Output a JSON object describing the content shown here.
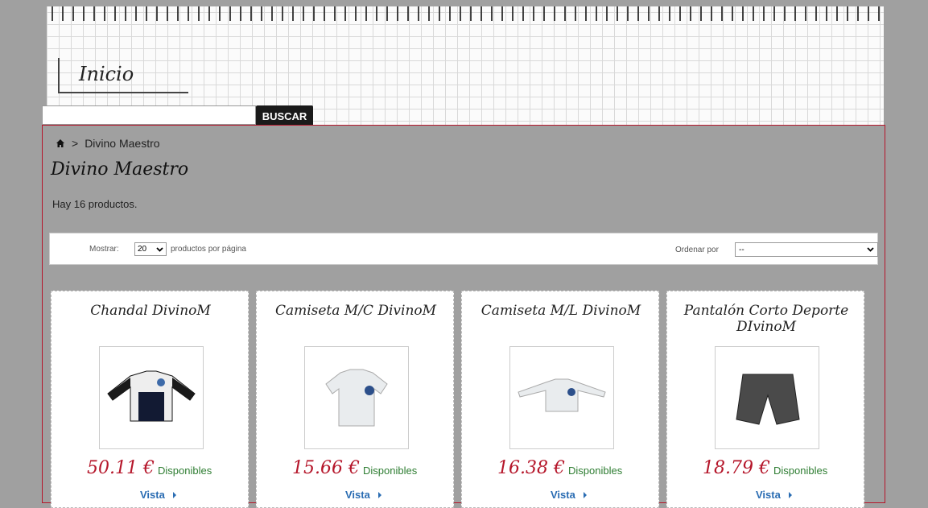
{
  "header": {
    "inicio_label": "Inicio",
    "search": {
      "placeholder": "",
      "button_label": "BUSCAR"
    }
  },
  "breadcrumb": {
    "separator": ">",
    "current": "Divino Maestro"
  },
  "category": {
    "title": "Divino Maestro",
    "count_text": "Hay 16 productos."
  },
  "toolbar": {
    "show_label": "Mostrar:",
    "show_value": "20",
    "per_page_label": "productos por página",
    "order_label": "Ordenar por",
    "order_value": "--"
  },
  "products": [
    {
      "title": "Chandal DivinoM",
      "price": "50.11 €",
      "availability": "Disponibles",
      "view_label": "Vista",
      "image": "tracksuit-jacket"
    },
    {
      "title": "Camiseta M/C DivinoM",
      "price": "15.66 €",
      "availability": "Disponibles",
      "view_label": "Vista",
      "image": "short-sleeve-shirt"
    },
    {
      "title": "Camiseta M/L DivinoM",
      "price": "16.38 €",
      "availability": "Disponibles",
      "view_label": "Vista",
      "image": "long-sleeve-shirt"
    },
    {
      "title": "Pantalón Corto Deporte DIvinoM",
      "price": "18.79 €",
      "availability": "Disponibles",
      "view_label": "Vista",
      "image": "shorts"
    }
  ],
  "colors": {
    "price": "#b5162a",
    "availability": "#2e7d32",
    "link": "#2b6db3",
    "frame_border": "#b5162a"
  }
}
